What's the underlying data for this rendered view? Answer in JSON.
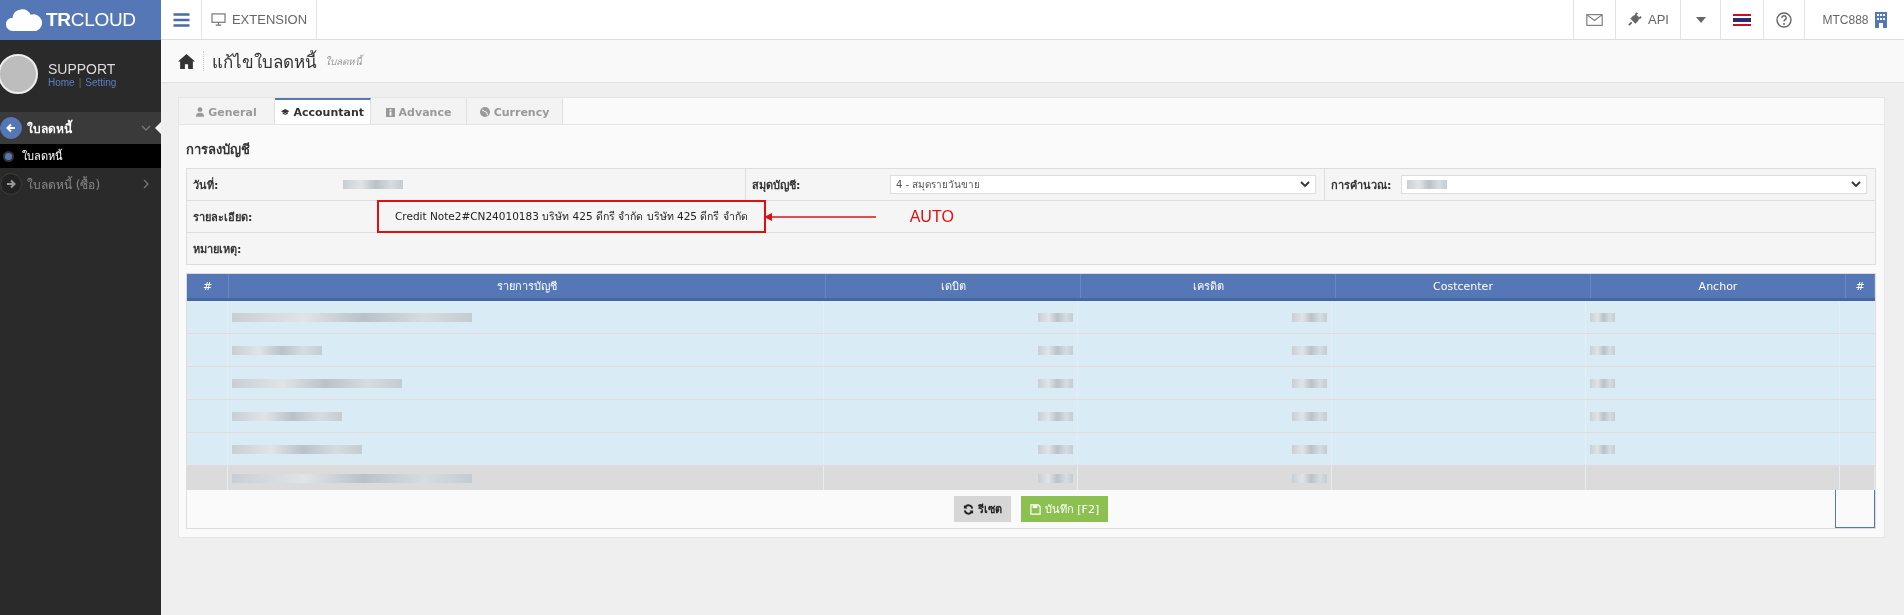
{
  "brand": {
    "logo": "**TR**CLOUD"
  },
  "topbar": {
    "extension": "EXTENSION",
    "api": "API",
    "user": "MTC888"
  },
  "profile": {
    "name": "SUPPORT",
    "links": [
      "Home",
      "Setting"
    ],
    "separator": "|"
  },
  "sidebar": {
    "items": [
      {
        "label": "ใบลดหนี้",
        "selected": true,
        "expanded": true,
        "children": [
          {
            "label": "ใบลดหนี้",
            "selected": true
          }
        ]
      },
      {
        "label": "ใบลดหนี้ (ซื้อ)",
        "selected": false,
        "expanded": false
      }
    ]
  },
  "page": {
    "title": "แก้ไขใบลดหนี้",
    "subtitle": "ใบลดหนี้"
  },
  "tabs": [
    {
      "label": "General",
      "selected": false,
      "kind": "user"
    },
    {
      "label": "Accountant",
      "selected": true,
      "kind": "cap"
    },
    {
      "label": "Advance",
      "selected": false,
      "kind": "info"
    },
    {
      "label": "Currency",
      "selected": false,
      "kind": "globe"
    }
  ],
  "section_title": "การลงบัญชี",
  "form": {
    "date_label": "วันที่:",
    "journal_label": "สมุดบัญชี:",
    "journal_value": "4 - สมุดรายวันขาย",
    "calc_label": "การคำนวณ:",
    "detail_label": "รายละเอียด:",
    "detail_value": "Credit Note2#CN24010183 บริษัท 425 ดีกรี จำกัด บริษัท 425 ดีกรี จำกัด",
    "note_label": "หมายเหตุ:"
  },
  "annotation": {
    "text": "AUTO"
  },
  "table": {
    "columns": [
      "#",
      "รายการบัญชี",
      "เดบิต",
      "เครดิต",
      "Costcenter",
      "Anchor",
      "#"
    ],
    "rows": [
      {
        "kind": "entry"
      },
      {
        "kind": "entry"
      },
      {
        "kind": "entry"
      },
      {
        "kind": "entry"
      },
      {
        "kind": "entry"
      },
      {
        "kind": "total"
      }
    ]
  },
  "buttons": [
    {
      "label": "รีเซต",
      "kind": "reset"
    },
    {
      "label": "บันทึก [F2]",
      "kind": "save"
    }
  ]
}
